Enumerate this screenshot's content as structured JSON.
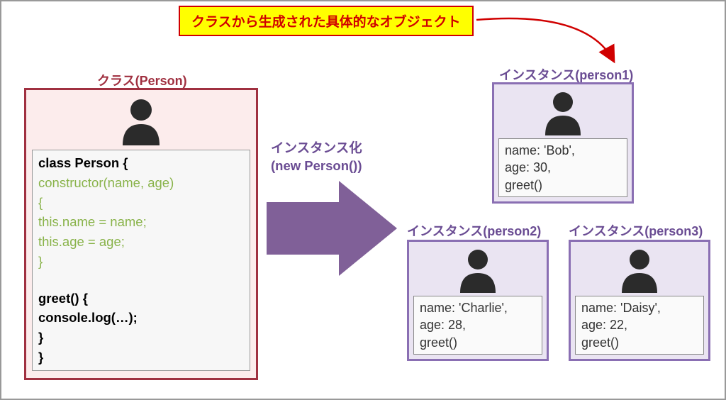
{
  "header": {
    "text": "クラスから生成された具体的なオブジェクト"
  },
  "class": {
    "label": "クラス(Person)",
    "code": {
      "l1": "class Person {",
      "l2": " constructor(name, age)",
      "l3": " {",
      "l4": "  this.name = name;",
      "l5": "  this.age = age;",
      "l6": " }",
      "l7": "",
      "l8": " greet() {",
      "l9": "  console.log(…);",
      "l10": " }",
      "l11": "}"
    }
  },
  "arrow": {
    "line1": "インスタンス化",
    "line2": "(new Person())"
  },
  "instances": [
    {
      "label": "インスタンス(person1)",
      "l1": "name: 'Bob',",
      "l2": "age: 30,",
      "l3": "greet()"
    },
    {
      "label": "インスタンス(person2)",
      "l1": "name: 'Charlie',",
      "l2": "age: 28,",
      "l3": "greet()"
    },
    {
      "label": "インスタンス(person3)",
      "l1": "name: 'Daisy',",
      "l2": "age: 22,",
      "l3": "greet()"
    }
  ],
  "colors": {
    "class_border": "#a03040",
    "instance_border": "#8a6fb3",
    "arrow": "#806098",
    "header_bg": "#ffff00",
    "header_border": "#d00000"
  }
}
